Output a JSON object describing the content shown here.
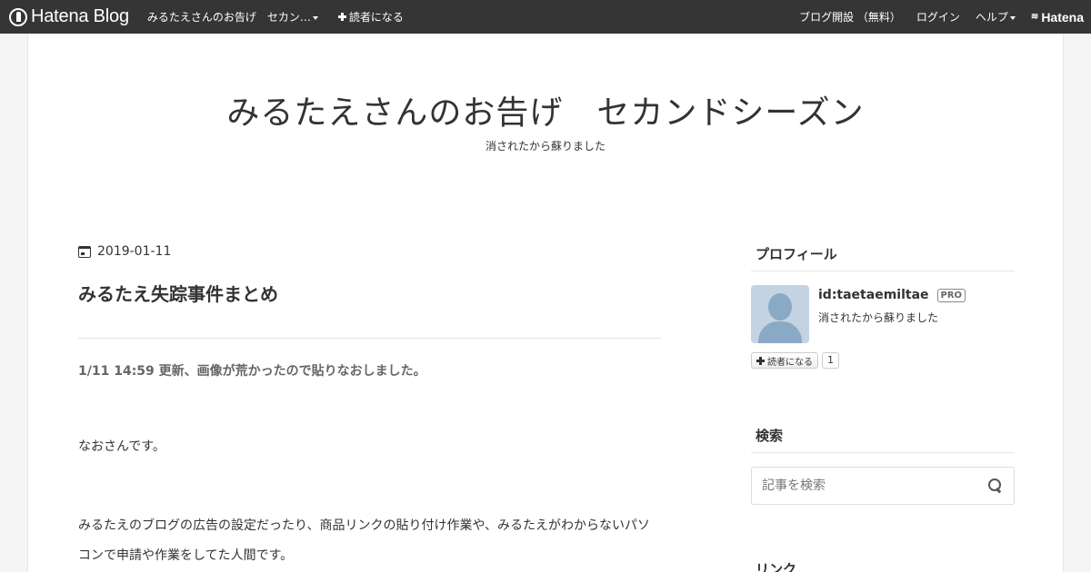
{
  "globalbar": {
    "logo_text": "Hatena Blog",
    "blog_name": "みるたえさんのお告げ　セカン…",
    "subscribe_label": "読者になる",
    "open_blog_label": "ブログ開設 （無料）",
    "login_label": "ログイン",
    "help_label": "ヘルプ",
    "hatena_label": "Hatena"
  },
  "header": {
    "title": "みるたえさんのお告げ　セカンドシーズン",
    "description": "消されたから蘇りました"
  },
  "article": {
    "date": "2019-01-11",
    "title": "みるたえ失踪事件まとめ",
    "update_note": "1/11 14:59 更新、画像が荒かったので貼りなおしました。",
    "intro": "なおさんです。",
    "paragraph": "みるたえのブログの広告の設定だったり、商品リンクの貼り付け作業や、みるたえがわからないパソコンで申請や作業をしてた人間です。"
  },
  "sidebar": {
    "profile": {
      "title": "プロフィール",
      "user_id": "id:taetaemiltae",
      "pro_badge": "PRO",
      "description": "消されたから蘇りました",
      "subscribe_label": "読者になる",
      "subscriber_count": "1"
    },
    "search": {
      "title": "検索",
      "placeholder": "記事を検索"
    },
    "links": {
      "title": "リンク"
    }
  },
  "colors": {
    "globalbar_bg": "#353535",
    "page_bg": "#f5f5f5",
    "content_bg": "#ffffff",
    "text": "#333333",
    "avatar_bg": "#c3d3e2"
  }
}
